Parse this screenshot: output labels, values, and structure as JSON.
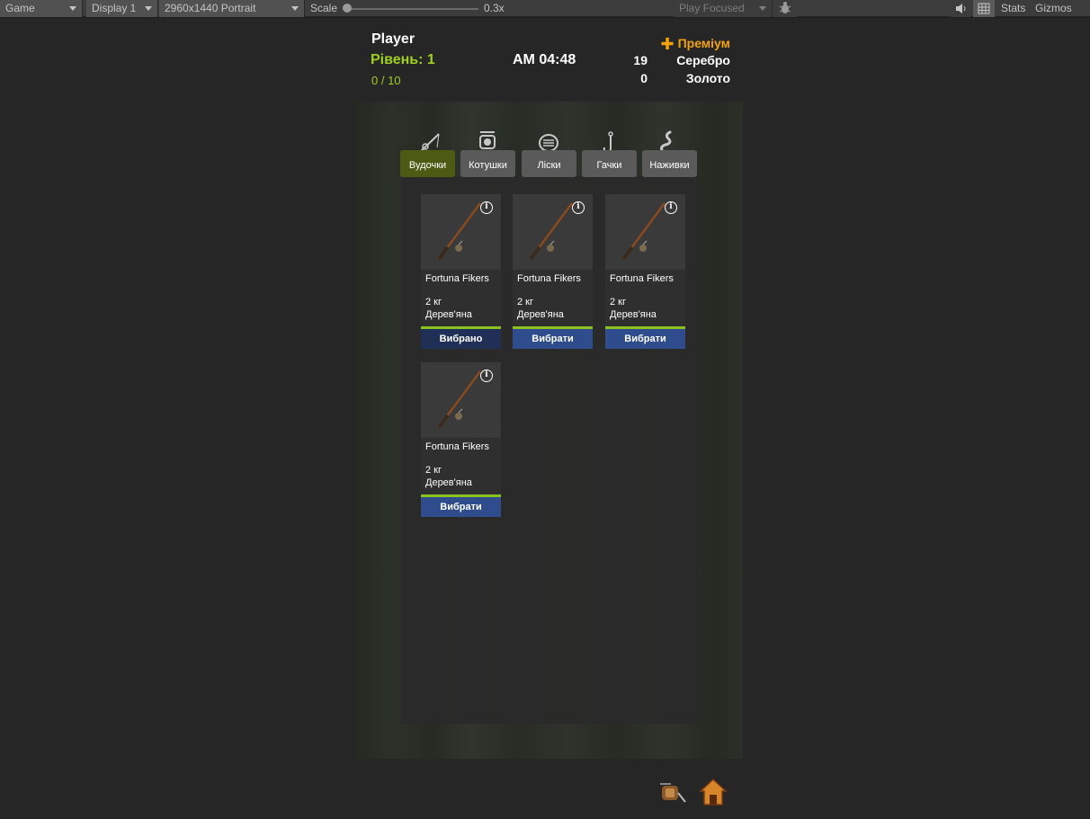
{
  "toolbar": {
    "game_tab": "Game",
    "display": "Display 1",
    "resolution": "2960x1440 Portrait",
    "scale_label": "Scale",
    "scale_value": "0.3x",
    "play_mode": "Play Focused",
    "stats": "Stats",
    "gizmos": "Gizmos"
  },
  "header": {
    "player_name": "Player",
    "level": "Рівень: 1",
    "xp": "0 / 10",
    "clock": "AM 04:48",
    "premium": "Преміум",
    "silver_count": "19",
    "silver_label": "Серебро",
    "gold_count": "0",
    "gold_label": "Золото"
  },
  "tabs": [
    {
      "label": "Вудочки",
      "icon": "fishing-rod-icon",
      "active": true
    },
    {
      "label": "Котушки",
      "icon": "reel-icon",
      "active": false
    },
    {
      "label": "Ліски",
      "icon": "line-spool-icon",
      "active": false
    },
    {
      "label": "Гачки",
      "icon": "hook-icon",
      "active": false
    },
    {
      "label": "Наживки",
      "icon": "worm-icon",
      "active": false
    }
  ],
  "items": [
    {
      "name": "Fortuna Fikers",
      "weight": "2 кг",
      "material": "Дерев'яна",
      "button": "Вибрано",
      "selected": true
    },
    {
      "name": "Fortuna Fikers",
      "weight": "2 кг",
      "material": "Дерев'яна",
      "button": "Вибрати",
      "selected": false
    },
    {
      "name": "Fortuna Fikers",
      "weight": "2 кг",
      "material": "Дерев'яна",
      "button": "Вибрати",
      "selected": false
    },
    {
      "name": "Fortuna Fikers",
      "weight": "2 кг",
      "material": "Дерев'яна",
      "button": "Вибрати",
      "selected": false
    }
  ],
  "colors": {
    "accent_green": "#9fcf1f",
    "premium_orange": "#f2a20f",
    "button_blue": "#2f4d8c"
  }
}
